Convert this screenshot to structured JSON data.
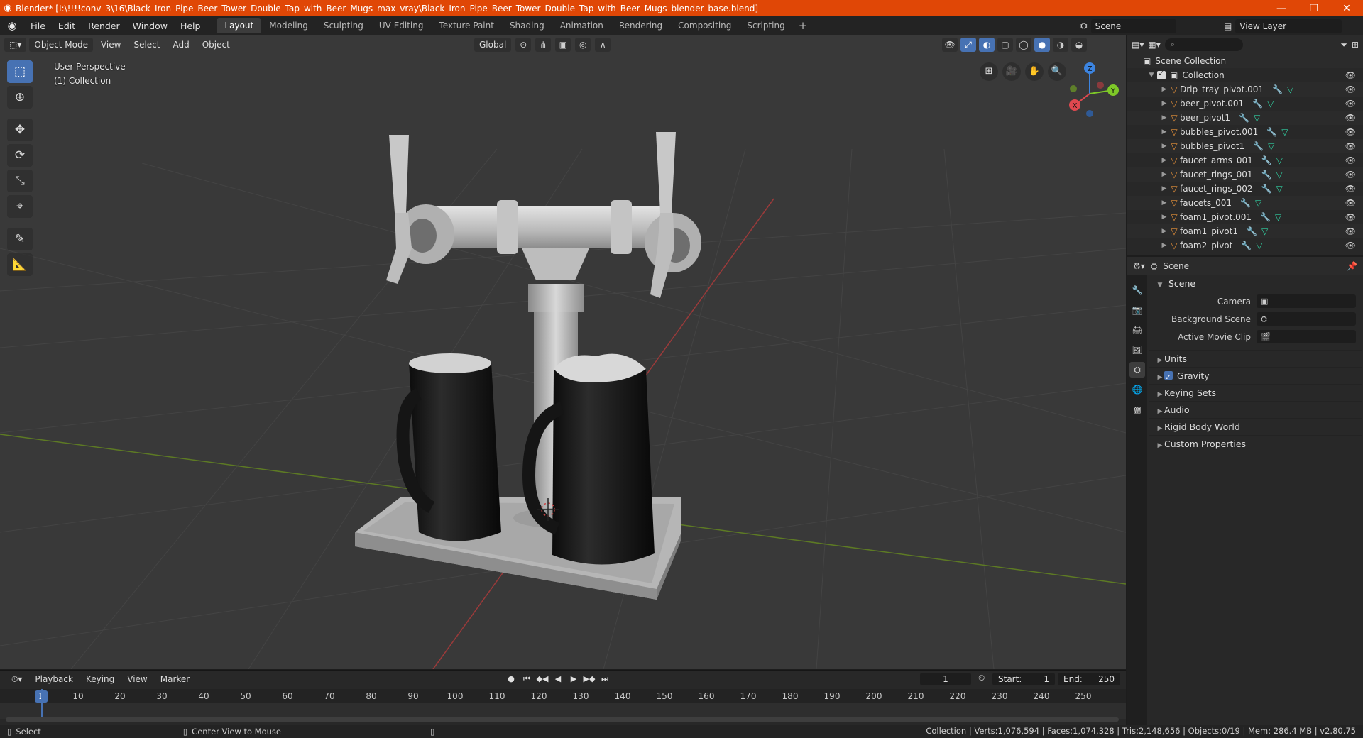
{
  "window": {
    "title": "Blender* [I:\\!!!!conv_3\\16\\Black_Iron_Pipe_Beer_Tower_Double_Tap_with_Beer_Mugs_max_vray\\Black_Iron_Pipe_Beer_Tower_Double_Tap_with_Beer_Mugs_blender_base.blend]",
    "minimize": "—",
    "maximize": "❐",
    "close": "✕"
  },
  "menu": [
    "File",
    "Edit",
    "Render",
    "Window",
    "Help"
  ],
  "workspaces": [
    "Layout",
    "Modeling",
    "Sculpting",
    "UV Editing",
    "Texture Paint",
    "Shading",
    "Animation",
    "Rendering",
    "Compositing",
    "Scripting"
  ],
  "active_workspace": "Layout",
  "scene_name": "Scene",
  "view_layer": "View Layer",
  "viewport": {
    "mode": "Object Mode",
    "menus": [
      "View",
      "Select",
      "Add",
      "Object"
    ],
    "orientation": "Global",
    "perspective_label": "User Perspective",
    "collection_label": "(1) Collection"
  },
  "gizmo": {
    "x": "X",
    "y": "Y",
    "z": "Z"
  },
  "outliner": {
    "root": "Scene Collection",
    "collection": "Collection",
    "objects": [
      "Drip_tray_pivot.001",
      "beer_pivot.001",
      "beer_pivot1",
      "bubbles_pivot.001",
      "bubbles_pivot1",
      "faucet_arms_001",
      "faucet_rings_001",
      "faucet_rings_002",
      "faucets_001",
      "foam1_pivot.001",
      "foam1_pivot1",
      "foam2_pivot"
    ]
  },
  "properties": {
    "header_name": "Scene",
    "panel_title": "Scene",
    "fields": [
      {
        "label": "Camera",
        "value": ""
      },
      {
        "label": "Background Scene",
        "value": ""
      },
      {
        "label": "Active Movie Clip",
        "value": ""
      }
    ],
    "subpanels": [
      "Units",
      "Gravity",
      "Keying Sets",
      "Audio",
      "Rigid Body World",
      "Custom Properties"
    ]
  },
  "timeline": {
    "menus": [
      "Playback",
      "Keying",
      "View",
      "Marker"
    ],
    "current_frame": "1",
    "start_label": "Start:",
    "start": "1",
    "end_label": "End:",
    "end": "250",
    "ticks": [
      "10",
      "20",
      "30",
      "40",
      "50",
      "60",
      "70",
      "80",
      "90",
      "100",
      "110",
      "120",
      "130",
      "140",
      "150",
      "160",
      "170",
      "180",
      "190",
      "200",
      "210",
      "220",
      "230",
      "240",
      "250"
    ]
  },
  "status": {
    "select": "Select",
    "center_view": "Center View to Mouse",
    "stats": "Collection | Verts:1,076,594 | Faces:1,074,328 | Tris:2,148,656 | Objects:0/19 | Mem: 286.4 MB | v2.80.75"
  },
  "colors": {
    "titlebar": "#e04706",
    "accent": "#4772b3",
    "object_icon": "#e8923a",
    "mesh_icon": "#31d0a2",
    "axis_x": "#e0484f",
    "axis_y": "#7ec828",
    "axis_z": "#3c84e0"
  }
}
